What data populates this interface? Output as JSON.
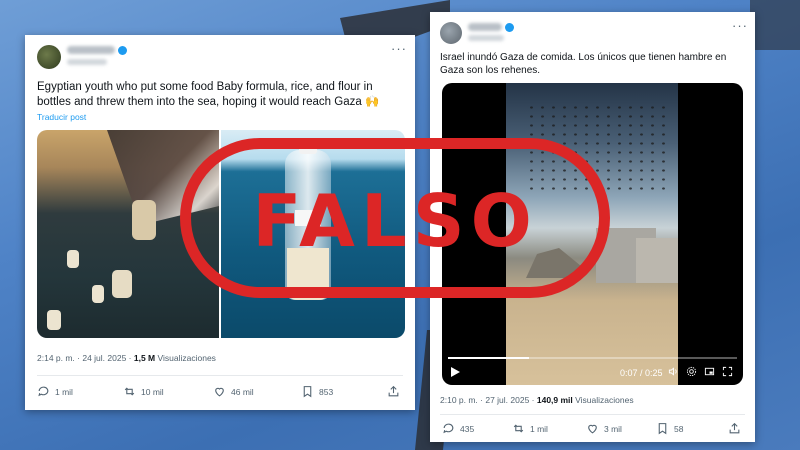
{
  "tweet_left": {
    "text": "Egyptian youth who put some food Baby formula, rice, and flour  in bottles and threw them into the sea, hoping it would reach Gaza 🙌",
    "translate_label": "Traducir post",
    "time": "2:14 p. m. · 24 jul. 2025 · ",
    "views_count": "1,5 M",
    "views_label": " Visualizaciones",
    "actions": {
      "replies": "1 mil",
      "reposts": "10 mil",
      "likes": "46 mil",
      "bookmarks": "853"
    }
  },
  "tweet_right": {
    "text": "Israel inundó Gaza de comida. Los únicos que tienen hambre en Gaza son los rehenes.",
    "time": "2:10 p. m. · 27 jul. 2025 · ",
    "views_count": "140,9 mil",
    "views_label": " Visualizaciones",
    "video": {
      "time": "0:07 / 0:25",
      "progress": 0.28
    },
    "actions": {
      "replies": "435",
      "reposts": "1 mil",
      "likes": "3 mil",
      "bookmarks": "58"
    }
  },
  "stamp": {
    "text": "FALSO",
    "color": "#dc2626"
  },
  "colors": {
    "accent": "#1d9bf0",
    "background": "#4f83c7"
  }
}
